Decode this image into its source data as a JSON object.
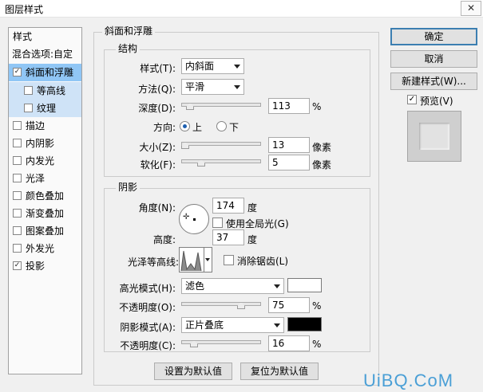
{
  "window": {
    "title": "图层样式",
    "close": "✕"
  },
  "styles_list": {
    "header": "样式",
    "blend_options": "混合选项:自定",
    "items": [
      {
        "label": "斜面和浮雕",
        "checked": true,
        "check": "✓"
      },
      {
        "label": "等高线",
        "checked": false
      },
      {
        "label": "纹理",
        "checked": false
      },
      {
        "label": "描边",
        "checked": false
      },
      {
        "label": "内阴影",
        "checked": false
      },
      {
        "label": "内发光",
        "checked": false
      },
      {
        "label": "光泽",
        "checked": false
      },
      {
        "label": "颜色叠加",
        "checked": false
      },
      {
        "label": "渐变叠加",
        "checked": false
      },
      {
        "label": "图案叠加",
        "checked": false
      },
      {
        "label": "外发光",
        "checked": false
      },
      {
        "label": "投影",
        "checked": true,
        "check": "✓"
      }
    ]
  },
  "bevel": {
    "group_title": "斜面和浮雕",
    "structure": {
      "title": "结构",
      "style_label": "样式(T):",
      "style_value": "内斜面",
      "technique_label": "方法(Q):",
      "technique_value": "平滑",
      "depth_label": "深度(D):",
      "depth_value": "113",
      "depth_unit": "%",
      "depth_level": 0.11,
      "direction_label": "方向:",
      "dir_up": "上",
      "dir_down": "下",
      "direction": "上",
      "size_label": "大小(Z):",
      "size_value": "13",
      "size_unit": "像素",
      "size_level": 0.05,
      "soften_label": "软化(F):",
      "soften_value": "5",
      "soften_unit": "像素",
      "soften_level": 0.25
    },
    "shading": {
      "title": "阴影",
      "angle_label": "角度(N):",
      "angle_value": "174",
      "angle_unit": "度",
      "global_light_label": "使用全局光(G)",
      "altitude_label": "高度:",
      "altitude_value": "37",
      "altitude_unit": "度",
      "gloss_label": "光泽等高线:",
      "antialias_label": "消除锯齿(L)",
      "highlight_label": "高光模式(H):",
      "highlight_mode": "滤色",
      "highlight_color": "#ffffff",
      "highlight_opacity_label": "不透明度(O):",
      "highlight_opacity": "75",
      "highlight_opacity_unit": "%",
      "highlight_level": 0.75,
      "shadow_label": "阴影模式(A):",
      "shadow_mode": "正片叠底",
      "shadow_color": "#000000",
      "shadow_opacity_label": "不透明度(C):",
      "shadow_opacity": "16",
      "shadow_opacity_unit": "%",
      "shadow_level": 0.16
    },
    "make_default": "设置为默认值",
    "reset_default": "复位为默认值"
  },
  "buttons": {
    "ok": "确定",
    "cancel": "取消",
    "new_style": "新建样式(W)...",
    "preview_label": "预览(V)",
    "preview_check": "✓"
  },
  "watermark": "UiBQ.CoM",
  "colors": {
    "selected_row": "#90c6f5",
    "sub_row": "#cfe3f7",
    "primary_border": "#3c7fb1",
    "watermark": "#4a9fd6"
  }
}
